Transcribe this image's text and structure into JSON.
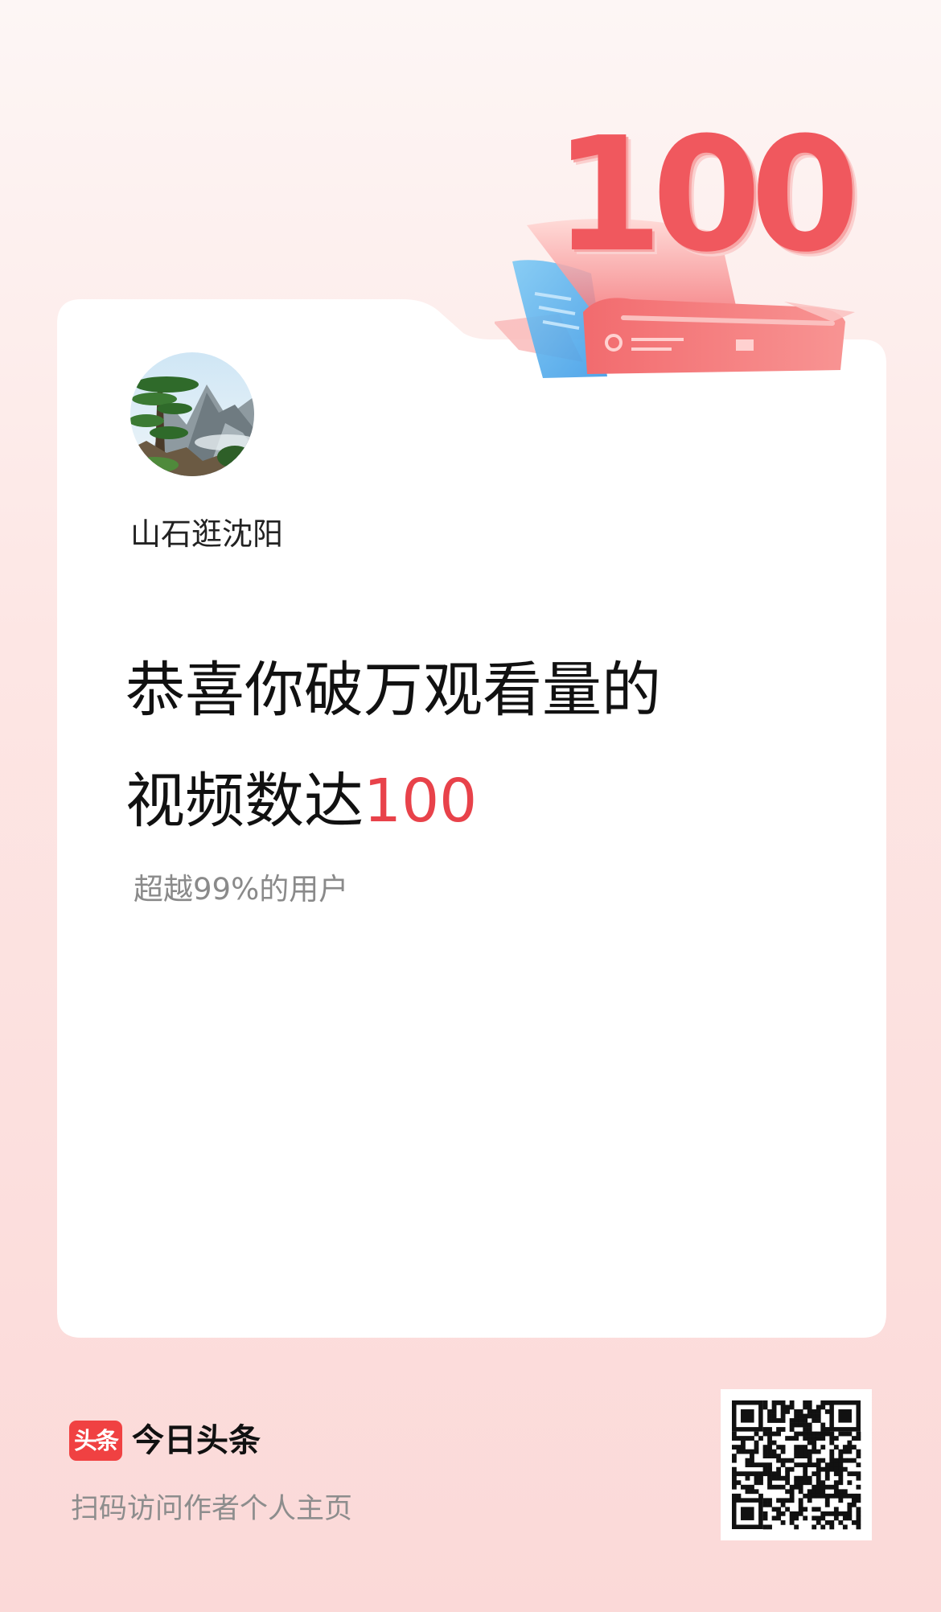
{
  "badge": {
    "number": "100"
  },
  "author": {
    "name": "山石逛沈阳"
  },
  "headline": {
    "line1": "恭喜你破万观看量的",
    "line2_prefix": "视频数达",
    "line2_highlight": "100"
  },
  "subline": "超越99%的用户",
  "footer": {
    "logo_text": "头条",
    "brand": "今日头条",
    "hint": "扫码访问作者个人主页"
  },
  "colors": {
    "accent": "#e8424a",
    "logo_red": "#f04142",
    "badge_red": "#f0585e",
    "badge_blue": "#5ab3f0"
  },
  "icons": {
    "avatar": "mountain-pine-landscape",
    "badge": "video-hundred-ribbon",
    "logo": "toutiao-logo",
    "qr": "qr-code"
  }
}
